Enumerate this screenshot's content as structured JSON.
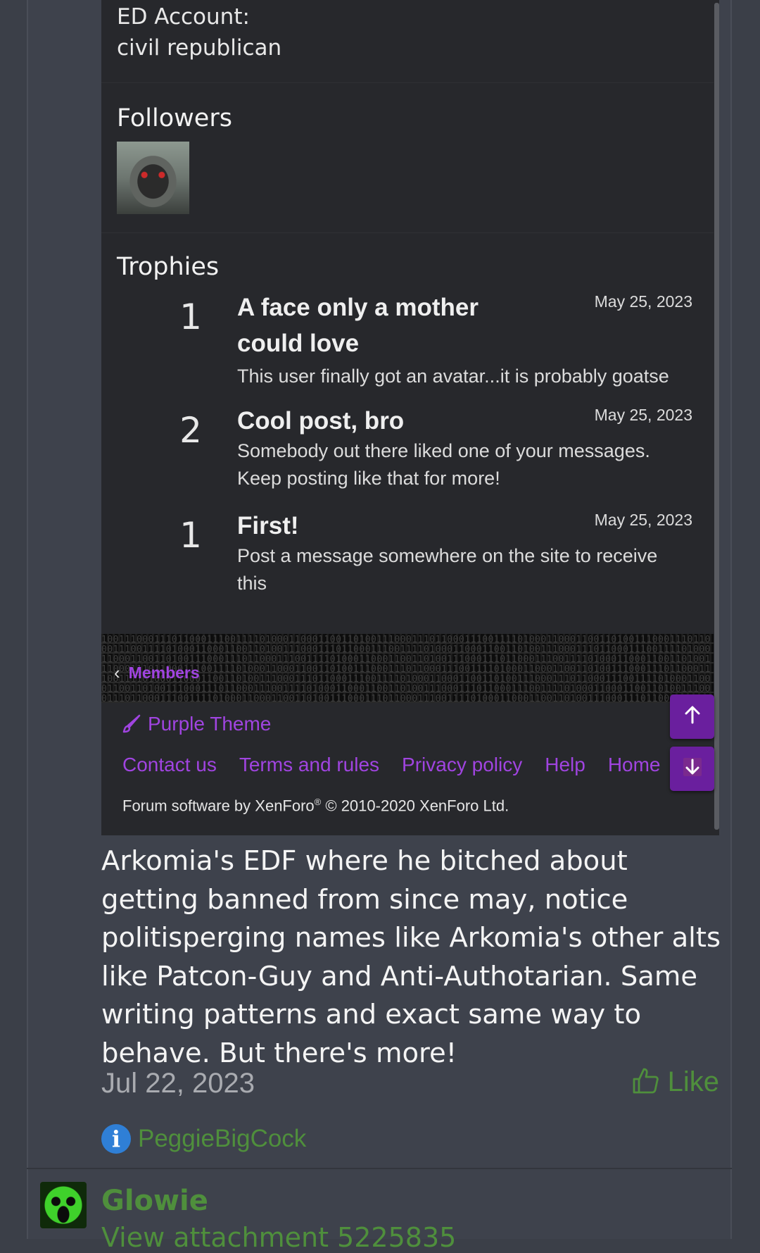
{
  "embed": {
    "ed_account_label": "ED Account:",
    "ed_account_value": "civil republican",
    "followers_title": "Followers",
    "trophies_title": "Trophies",
    "trophies": [
      {
        "points": "1",
        "title": "A face only a mother could love",
        "description": "This user finally got an avatar...it is probably goatse",
        "date": "May 25, 2023"
      },
      {
        "points": "2",
        "title": "Cool post, bro",
        "description": "Somebody out there liked one of your messages. Keep posting like that for more!",
        "date": "May 25, 2023"
      },
      {
        "points": "1",
        "title": "First!",
        "description": "Post a message somewhere on the site to receive this",
        "date": "May 25, 2023"
      }
    ],
    "back_link": "Members",
    "theme_label": "Purple Theme",
    "footer_links": [
      "Contact us",
      "Terms and rules",
      "Privacy policy",
      "Help",
      "Home"
    ],
    "copyright_prefix": "Forum software by XenForo",
    "copyright_mark": "®",
    "copyright_suffix": " © 2010-2020 XenForo Ltd.",
    "accent_color": "#a044e0"
  },
  "post": {
    "text": "Arkomia's EDF where he bitched about getting banned from since may, notice politisperging names like Arkomia's other alts like Patcon-Guy and Anti-Authotarian. Same writing patterns and exact same way to behave. But there's more!",
    "date": "Jul 22, 2023",
    "like_label": "Like",
    "reactor": "PeggieBigCock"
  },
  "next_post": {
    "username": "Glowie",
    "attachment_text": "View attachment 5225835"
  },
  "colors": {
    "link_green": "#4f8f3c",
    "info_blue": "#2f7fd6",
    "button_purple": "#6a1f9e"
  },
  "icons": [
    "chevron-left-icon",
    "paintbrush-icon",
    "arrow-up-icon",
    "arrow-down-icon",
    "thumbs-up-icon",
    "info-icon"
  ]
}
